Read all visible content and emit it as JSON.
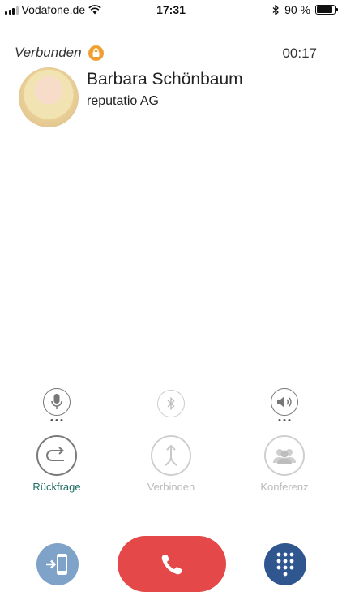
{
  "status_bar": {
    "carrier": "Vodafone.de",
    "time": "17:31",
    "battery_percent": "90 %",
    "battery_level": 0.9
  },
  "call": {
    "status": "Verbunden",
    "timer": "00:17",
    "lock_icon": "lock-icon",
    "lock_color": "#f0a030"
  },
  "contact": {
    "name": "Barbara Schönbaum",
    "company": "reputatio AG"
  },
  "audio_controls": [
    {
      "icon": "microphone-icon",
      "enabled": true
    },
    {
      "icon": "bluetooth-icon",
      "enabled": false
    },
    {
      "icon": "speaker-icon",
      "enabled": true
    }
  ],
  "actions": {
    "consult": {
      "label": "Rückfrage",
      "icon": "consult-arrow-icon",
      "enabled": true
    },
    "connect": {
      "label": "Verbinden",
      "icon": "merge-arrows-icon",
      "enabled": false
    },
    "conference": {
      "label": "Konferenz",
      "icon": "people-icon",
      "enabled": false
    }
  },
  "bottom": {
    "handoff_icon": "handoff-phone-icon",
    "hangup_icon": "hang-up-icon",
    "keypad_icon": "dialpad-icon"
  },
  "colors": {
    "accent": "#1f6e62",
    "hangup": "#e54848",
    "handoff": "#7fa2c8",
    "keypad": "#2f568f"
  }
}
